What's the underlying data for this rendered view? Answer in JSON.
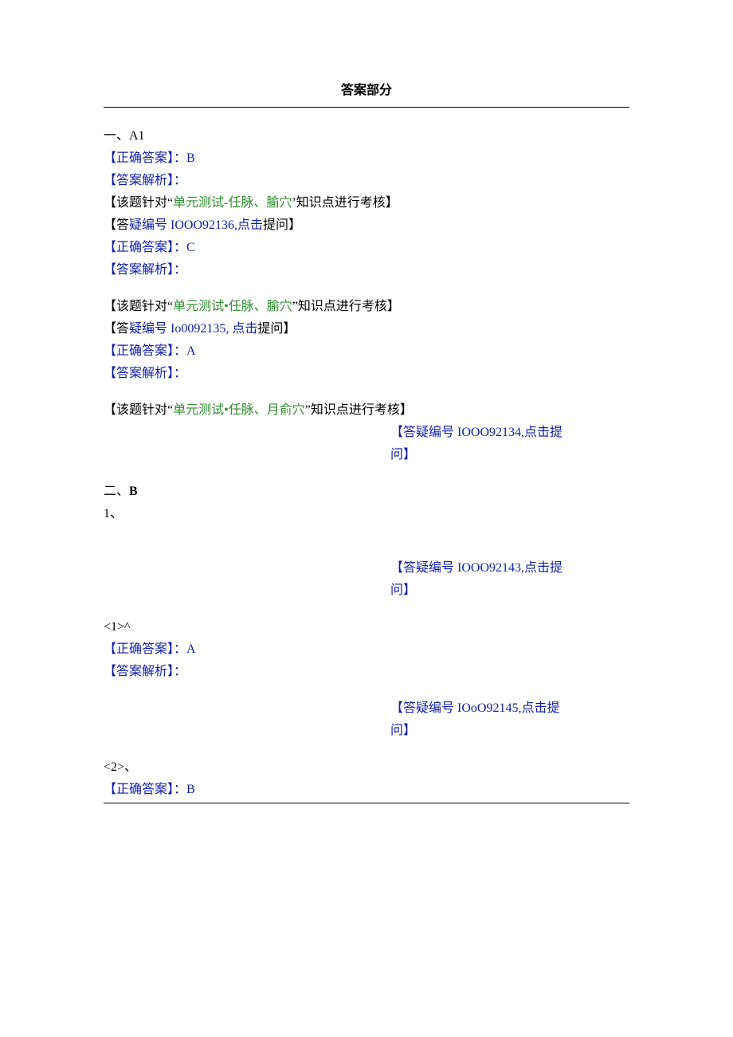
{
  "header": {
    "title": "答案部分"
  },
  "section_a": {
    "heading": "一、A1",
    "items": [
      {
        "correct_label": "【正确答案】：B",
        "analysis_label": "【答案解析】：",
        "note_prefix": "【该题针对“",
        "note_green": "单元测试-任脉、腧穴",
        "note_suffix": "’知识点进行考核】",
        "doubt_prefix": "【答",
        "doubt_blue": "疑编号 IOOO92136,点击",
        "doubt_suffix": "提问】"
      },
      {
        "correct_label": "【正确答案】：C",
        "analysis_label": "【答案解析】：",
        "note_prefix": "【该题针对“",
        "note_green": "单元测试•任脉、腧穴",
        "note_suffix": "”知识点进行考核】",
        "doubt_prefix": "【答",
        "doubt_blue": "疑编号 Io0092135, 点击",
        "doubt_suffix": "提问】"
      },
      {
        "correct_label": "【正确答案】：A",
        "analysis_label": "【答案解析】：",
        "note_prefix": "【该题针对“",
        "note_green": "单元测试•任脉、月俞穴",
        "note_suffix": "”知识点进行考核】",
        "doubt_line1": "【答疑编号 IOOO92134,点击提",
        "doubt_line2": "问】"
      }
    ]
  },
  "section_b": {
    "heading_prefix": "二、",
    "heading_bold": "B",
    "q1": "1、",
    "doubt1_line1": "【答疑编号 IOOO92143,点击提",
    "doubt1_line2": "问】",
    "sub1_label": "<1>^",
    "sub1_correct": "【正确答案】：A",
    "sub1_analysis": "【答案解析】：",
    "doubt2_line1": "【答疑编号 IOoO92145,点击提",
    "doubt2_line2": "问】",
    "sub2_label": "<2>、",
    "sub2_correct": "【正确答案】：B"
  }
}
